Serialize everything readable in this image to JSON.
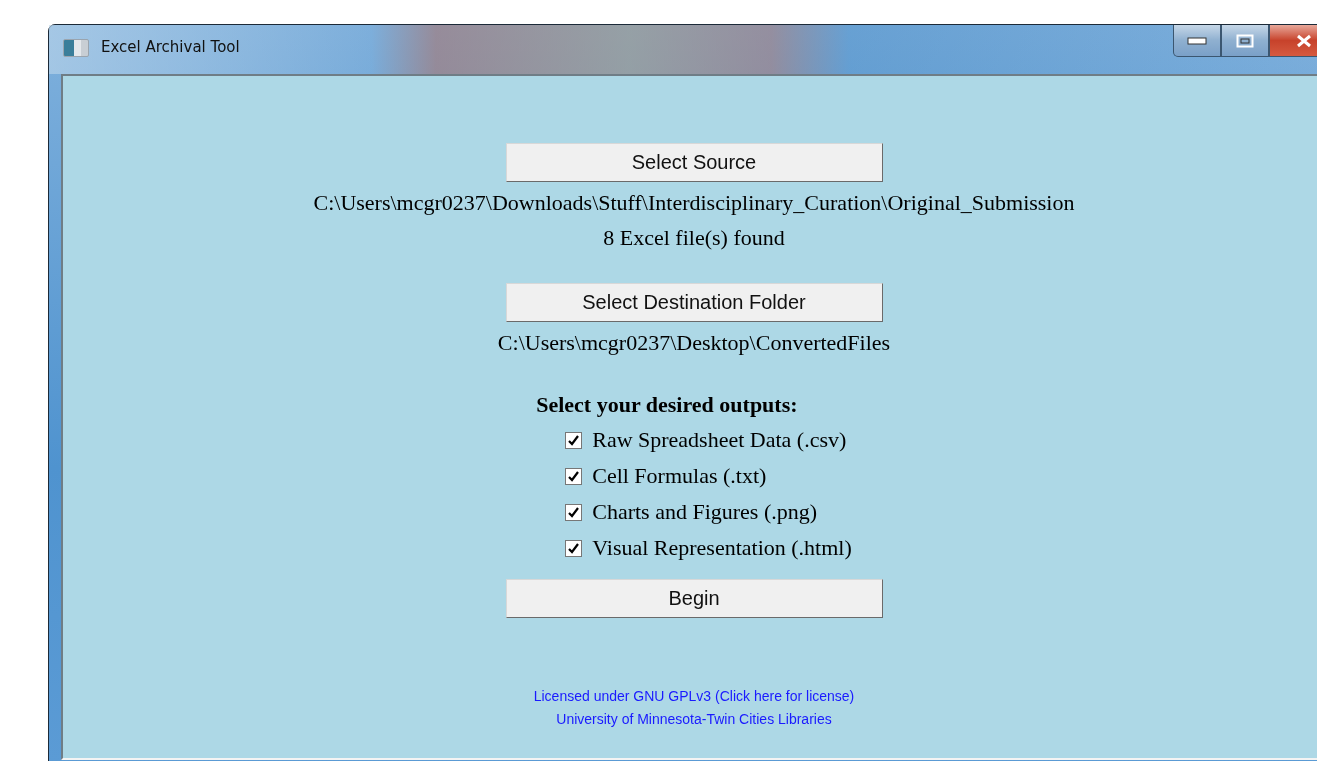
{
  "window": {
    "title": "Excel Archival Tool"
  },
  "source": {
    "button": "Select Source",
    "path": "C:\\Users\\mcgr0237\\Downloads\\Stuff\\Interdisciplinary_Curation\\Original_Submission",
    "status": "8 Excel file(s) found"
  },
  "destination": {
    "button": "Select Destination Folder",
    "path": "C:\\Users\\mcgr0237\\Desktop\\ConvertedFiles"
  },
  "outputs": {
    "heading": "Select your desired outputs:",
    "options": [
      {
        "label": "Raw Spreadsheet Data (.csv)",
        "checked": true
      },
      {
        "label": "Cell Formulas (.txt)",
        "checked": true
      },
      {
        "label": "Charts and Figures (.png)",
        "checked": true
      },
      {
        "label": "Visual Representation (.html)",
        "checked": true
      }
    ]
  },
  "begin_button": "Begin",
  "footer": {
    "license_link": "Licensed under GNU GPLv3 (Click here for license)",
    "credit": "University of Minnesota-Twin Cities Libraries"
  }
}
